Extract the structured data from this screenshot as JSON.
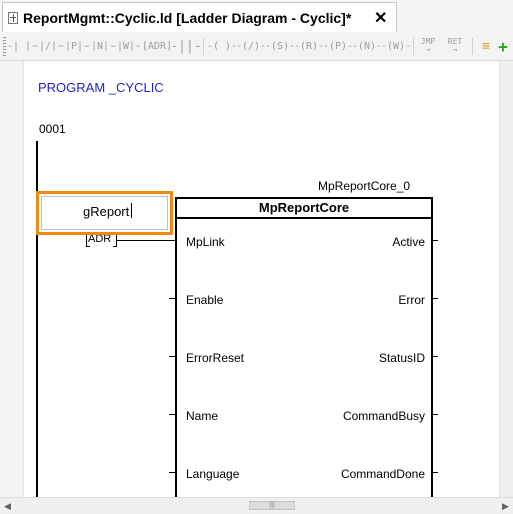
{
  "tab": {
    "title": "ReportMgmt::Cyclic.ld [Ladder Diagram - Cyclic]*",
    "close_glyph": "✕",
    "icon": "ladder-file-icon"
  },
  "toolbar": {
    "buttons": [
      {
        "name": "contact-no-icon",
        "glyph": "-| |-"
      },
      {
        "name": "contact-nc-icon",
        "glyph": "-|/|-"
      },
      {
        "name": "contact-positive-icon",
        "glyph": "-|P|-"
      },
      {
        "name": "contact-negative-icon",
        "glyph": "-|N|-"
      },
      {
        "name": "contact-w-icon",
        "glyph": "-|W|-"
      },
      {
        "name": "contact-adr-icon",
        "glyph": "[ADR]"
      },
      {
        "name": "contact-parallel-icon",
        "glyph": "-||-"
      },
      {
        "name": "coil-icon",
        "glyph": "-( )-"
      },
      {
        "name": "coil-negated-icon",
        "glyph": "-(/)-"
      },
      {
        "name": "coil-set-icon",
        "glyph": "-(S)-"
      },
      {
        "name": "coil-reset-icon",
        "glyph": "-(R)-"
      },
      {
        "name": "coil-positive-icon",
        "glyph": "-(P)-"
      },
      {
        "name": "coil-negative-icon",
        "glyph": "-(N)-"
      },
      {
        "name": "coil-w-icon",
        "glyph": "-(W)-"
      },
      {
        "name": "jump-icon",
        "top": "JMP",
        "bottom": "→"
      },
      {
        "name": "return-icon",
        "top": "RET",
        "bottom": "→"
      },
      {
        "name": "insert-network-icon",
        "glyph": "≡"
      },
      {
        "name": "add-network-icon",
        "glyph": "+"
      }
    ]
  },
  "program": {
    "label": "PROGRAM _CYCLIC",
    "network_number": "0001"
  },
  "function_block": {
    "instance": "MpReportCore_0",
    "type": "MpReportCore",
    "inputs": [
      "MpLink",
      "Enable",
      "ErrorReset",
      "Name",
      "Language"
    ],
    "outputs": [
      "Active",
      "Error",
      "StatusID",
      "CommandBusy",
      "CommandDone"
    ]
  },
  "variable_input": {
    "value": "gReport",
    "adr_label": "ADR"
  },
  "scrollbar": {
    "left_arrow": "◀",
    "right_arrow": "▶",
    "thumb_grip": "|||"
  }
}
